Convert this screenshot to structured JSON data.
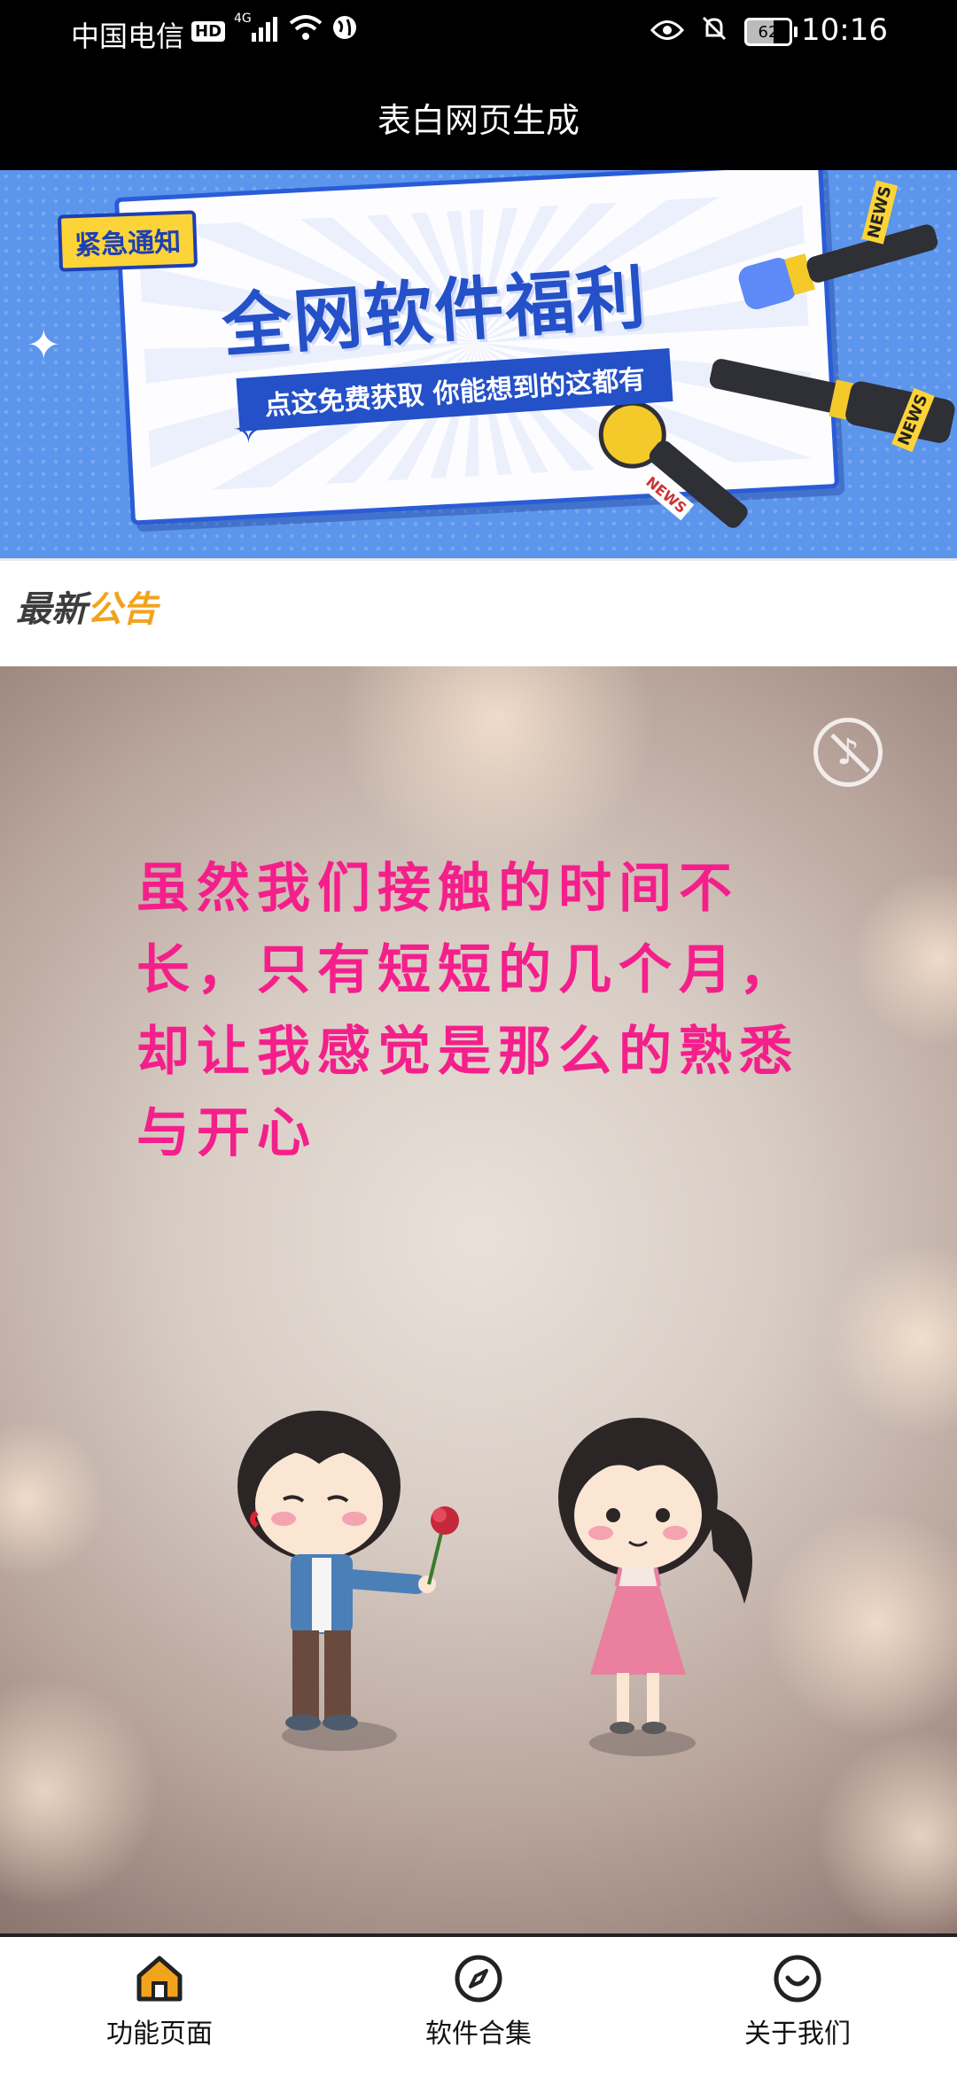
{
  "status_bar": {
    "carrier": "中国电信",
    "hd": "HD",
    "network": "4G",
    "battery": "62",
    "time": "10:16"
  },
  "header": {
    "title": "表白网页生成"
  },
  "banner": {
    "tag": "紧急通知",
    "headline": "全网软件福利",
    "subline": "点这免费获取 你能想到的这都有",
    "mic_label": "NEWS"
  },
  "announcement": {
    "label_part1": "最新",
    "label_part2": "公告"
  },
  "love_card": {
    "message": "虽然我们接触的时间不长，只有短短的几个月，却让我感觉是那么的熟悉与开心",
    "text_color": "#f51f8b"
  },
  "bottom_nav": {
    "items": [
      {
        "label": "功能页面",
        "icon": "home-icon",
        "active": true
      },
      {
        "label": "软件合集",
        "icon": "compass-icon",
        "active": false
      },
      {
        "label": "关于我们",
        "icon": "smile-icon",
        "active": false
      }
    ],
    "accent": "#f2a31d"
  }
}
